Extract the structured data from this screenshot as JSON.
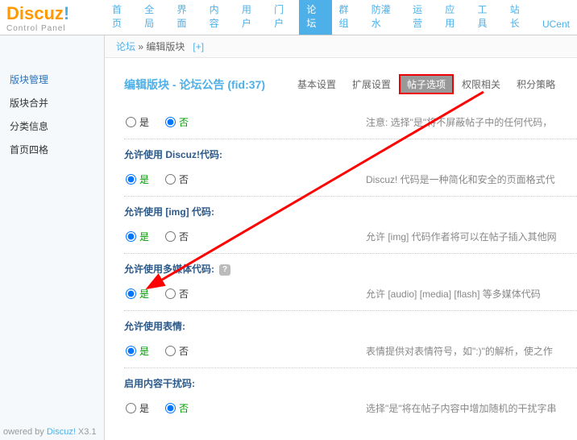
{
  "logo": {
    "brand": "Discuz",
    "excl": "!",
    "sub": "Control Panel"
  },
  "topnav": {
    "items": [
      "首页",
      "全局",
      "界面",
      "内容",
      "用户",
      "门户",
      "论坛",
      "群组",
      "防灌水",
      "运营",
      "应用",
      "工具",
      "站长",
      "UCent"
    ],
    "active": 6
  },
  "breadcrumb": {
    "a": "论坛",
    "sep": " » ",
    "b": "编辑版块",
    "add": "[+]"
  },
  "sidebar": {
    "items": [
      "版块管理",
      "版块合并",
      "分类信息",
      "首页四格"
    ],
    "active": 0
  },
  "title": "编辑版块 - 论坛公告 (fid:37)",
  "tabs": {
    "items": [
      "基本设置",
      "扩展设置",
      "帖子选项",
      "权限相关",
      "积分策略"
    ],
    "active": 2
  },
  "opt": {
    "yes": "是",
    "no": "否"
  },
  "settings": [
    {
      "label": "",
      "yes": false,
      "desc": "注意: 选择\"是\"将不屏蔽帖子中的任何代码，"
    },
    {
      "label": "允许使用 Discuz!代码:",
      "yes": true,
      "desc": "Discuz! 代码是一种简化和安全的页面格式代"
    },
    {
      "label": "允许使用 [img] 代码:",
      "yes": true,
      "desc": "允许 [img] 代码作者将可以在帖子插入其他网"
    },
    {
      "label": "允许使用多媒体代码:",
      "yes": true,
      "desc": "允许 [audio] [media] [flash] 等多媒体代码",
      "help": true
    },
    {
      "label": "允许使用表情:",
      "yes": true,
      "desc": "表情提供对表情符号，如\":)\"的解析，使之作"
    },
    {
      "label": "启用内容干扰码:",
      "yes": false,
      "desc": "选择\"是\"将在帖子内容中增加随机的干扰字串"
    }
  ],
  "footer": {
    "text": "owered by ",
    "link": "Discuz!",
    "ver": " X3.1"
  }
}
